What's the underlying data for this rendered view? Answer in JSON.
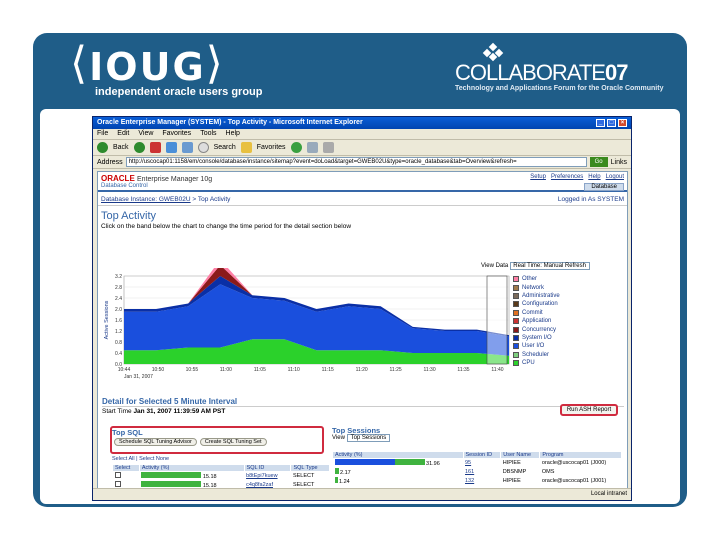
{
  "slide": {
    "brand_left": "IOUG",
    "brand_left_sub": "independent oracle users group",
    "brand_right": "COLLABORATE",
    "brand_right_year": "07",
    "brand_right_sub": "Technology and Applications Forum for the Oracle Community",
    "banner_color": "#1f5d88"
  },
  "browser": {
    "title": "Oracle Enterprise Manager (SYSTEM) - Top Activity - Microsoft Internet Explorer",
    "menu": [
      "File",
      "Edit",
      "View",
      "Favorites",
      "Tools",
      "Help"
    ],
    "toolbar": {
      "back": "Back",
      "search": "Search",
      "favorites": "Favorites"
    },
    "address_label": "Address",
    "address": "http://uscocap01:1158/em/console/database/instance/sitemap?event=doLoad&target=GWEB02U&type=oracle_database&tab=Overview&refresh=",
    "go_label": "Go",
    "links_label": "Links",
    "status_text": "Local intranet"
  },
  "oem": {
    "brand": "ORACLE",
    "product": "Enterprise Manager 10g",
    "sub": "Database Control",
    "links": [
      "Setup",
      "Preferences",
      "Help",
      "Logout"
    ],
    "db_tab": "Database",
    "breadcrumb": {
      "link": "Database Instance: GWEB02U",
      "current": "Top Activity"
    },
    "logged_in": "Logged in As SYSTEM",
    "page_title": "Top Activity",
    "instructions": "Click on the band below the chart to change the time period for the detail section below",
    "view_data_label": "View Data",
    "view_data_value": "Real Time: Manual Refresh"
  },
  "chart_data": {
    "type": "area",
    "ylabel": "Active Sessions",
    "ylim": [
      0,
      3.2
    ],
    "yticks": [
      "3.2",
      "2.8",
      "2.4",
      "2.0",
      "1.6",
      "1.2",
      "0.8",
      "0.4",
      "0.0"
    ],
    "x": [
      "10:44",
      "10:50",
      "10:55",
      "11:00",
      "11:05",
      "11:10",
      "11:15",
      "11:20",
      "11:25",
      "11:30",
      "11:35",
      "11:40"
    ],
    "xsub": "Jan 31, 2007",
    "series": [
      {
        "name": "CPU",
        "color": "#2bd12b",
        "values": [
          0.5,
          0.5,
          0.6,
          0.6,
          0.9,
          0.9,
          0.5,
          0.5,
          0.5,
          0.4,
          0.4,
          0.4,
          0.3
        ]
      },
      {
        "name": "User I/O",
        "color": "#1a4fdd",
        "values": [
          1.4,
          1.4,
          1.5,
          2.3,
          1.5,
          1.4,
          1.4,
          1.6,
          1.5,
          0.9,
          0.8,
          0.8,
          0.7
        ]
      },
      {
        "name": "System I/O",
        "color": "#0a2fa6",
        "values": [
          0.1,
          0.1,
          0.1,
          0.3,
          0.1,
          0.1,
          0.1,
          0.1,
          0.1,
          0.05,
          0.05,
          0.05,
          0.05
        ]
      },
      {
        "name": "Concurrency",
        "color": "#8b1a1a",
        "values": [
          0,
          0,
          0,
          0.4,
          0,
          0,
          0,
          0,
          0,
          0,
          0,
          0,
          0
        ]
      },
      {
        "name": "Other",
        "color": "#ff7fa6",
        "values": [
          0,
          0,
          0,
          0.2,
          0,
          0,
          0,
          0,
          0,
          0,
          0,
          0,
          0
        ]
      }
    ],
    "legend": [
      "Other",
      "Network",
      "Administrative",
      "Configuration",
      "Commit",
      "Application",
      "Concurrency",
      "System I/O",
      "User I/O",
      "Scheduler",
      "CPU"
    ],
    "legend_colors": [
      "#ff7fa6",
      "#a07a4a",
      "#7a6a5a",
      "#5a3a1a",
      "#e07020",
      "#cc3333",
      "#8b1a1a",
      "#0a2fa6",
      "#1a4fdd",
      "#7fd07f",
      "#2bd12b"
    ]
  },
  "detail": {
    "title": "Detail for Selected 5 Minute Interval",
    "start_time_label": "Start Time",
    "start_time": "Jan 31, 2007 11:39:59 AM PST",
    "run_report": "Run ASH Report"
  },
  "top_sql": {
    "title": "Top SQL",
    "buttons": [
      "Schedule SQL Tuning Advisor",
      "Create SQL Tuning Set"
    ],
    "select": "Select All | Select None",
    "columns": [
      "Select",
      "Activity (%)",
      "SQL ID",
      "SQL Type"
    ],
    "rows": [
      {
        "activity": "15.18",
        "sqlid": "b8tEpi7kuew",
        "type": "SELECT"
      },
      {
        "activity": "15.18",
        "sqlid": "c4q8fa2zaf",
        "type": "SELECT"
      }
    ]
  },
  "top_sessions": {
    "title": "Top Sessions",
    "view_label": "View",
    "view_value": "Top Sessions",
    "columns": [
      "Activity (%)",
      "Session ID",
      "User Name",
      "Program"
    ],
    "rows": [
      {
        "activity": "31.96",
        "sid": "95",
        "user": "HIPIEE",
        "program": "oracle@uscocap01 (J000)"
      },
      {
        "activity": "2.17",
        "sid": "161",
        "user": "DBSNMP",
        "program": "OMS"
      },
      {
        "activity": "1.24",
        "sid": "132",
        "user": "HIPIEE",
        "program": "oracle@uscocap01 (J001)"
      }
    ]
  }
}
